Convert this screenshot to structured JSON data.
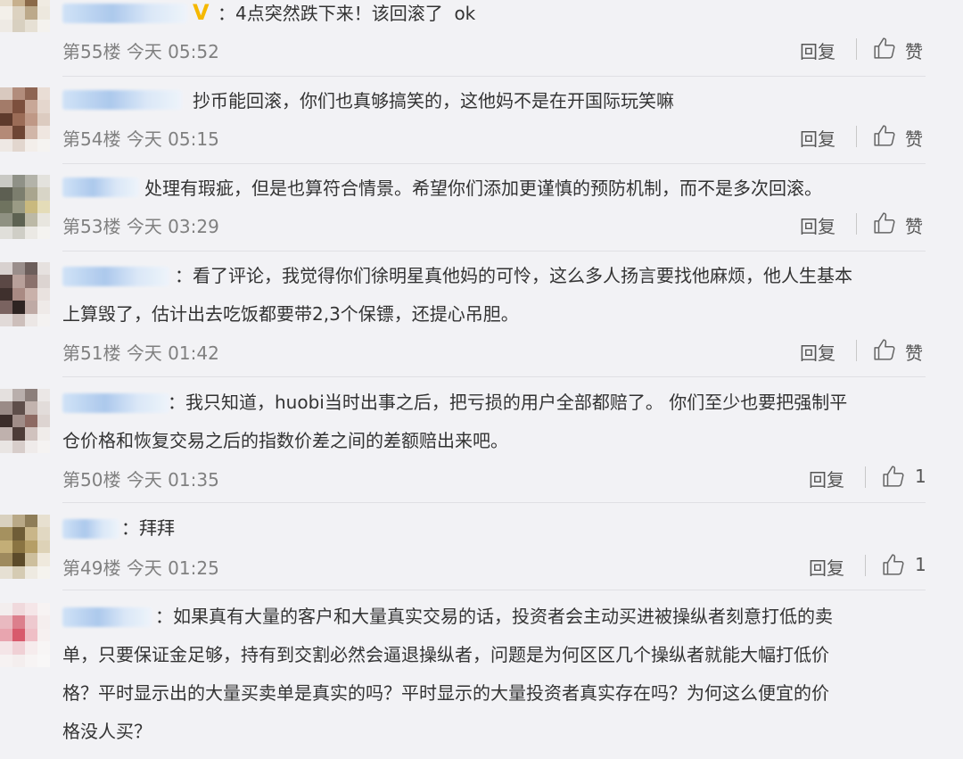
{
  "comments": [
    {
      "text": "：4点突然跌下来！该回滚了  ok",
      "floor": "第55楼",
      "time": "今天 05:52",
      "reply": "回复",
      "likes": "赞"
    },
    {
      "text": "抄币能回滚，你们也真够搞笑的，这他妈不是在开国际玩笑嘛",
      "floor": "第54楼",
      "time": "今天 05:15",
      "reply": "回复",
      "likes": "赞"
    },
    {
      "text": "处理有瑕疵，但是也算符合情景。希望你们添加更谨慎的预防机制，而不是多次回滚。",
      "floor": "第53楼",
      "time": "今天 03:29",
      "reply": "回复",
      "likes": "赞"
    },
    {
      "text": "：看了评论，我觉得你们徐明星真他妈的可怜，这么多人扬言要找他麻烦，他人生基本\n上算毁了，估计出去吃饭都要带2,3个保镖，还提心吊胆。",
      "floor": "第51楼",
      "time": "今天 01:42",
      "reply": "回复",
      "likes": "赞"
    },
    {
      "text": "：我只知道，huobi当时出事之后，把亏损的用户全部都赔了。 你们至少也要把强制平\n仓价格和恢复交易之后的指数价差之间的差额赔出来吧。",
      "floor": "第50楼",
      "time": "今天 01:35",
      "reply": "回复",
      "likes": "1"
    },
    {
      "text": "：拜拜",
      "floor": "第49楼",
      "time": "今天 01:25",
      "reply": "回复",
      "likes": "1"
    },
    {
      "text": "：如果真有大量的客户和大量真实交易的话，投资者会主动买进被操纵者刻意打低的卖\n单，只要保证金足够，持有到交割必然会逼退操纵者，问题是为何区区几个操纵者就能大幅打低价\n格？平时显示出的大量买卖单是真实的吗？平时显示的大量投资者真实存在吗？为何这么便宜的价\n格没人买？",
      "floor": "",
      "time": "",
      "reply": "",
      "likes": ""
    }
  ],
  "colors": {
    "text": "#333333",
    "meta": "#808080",
    "verified": "#f5b800",
    "name_blur": "#a9c7ec"
  },
  "icons": {
    "verified": "verified-v-icon",
    "like": "thumbs-up-icon"
  }
}
